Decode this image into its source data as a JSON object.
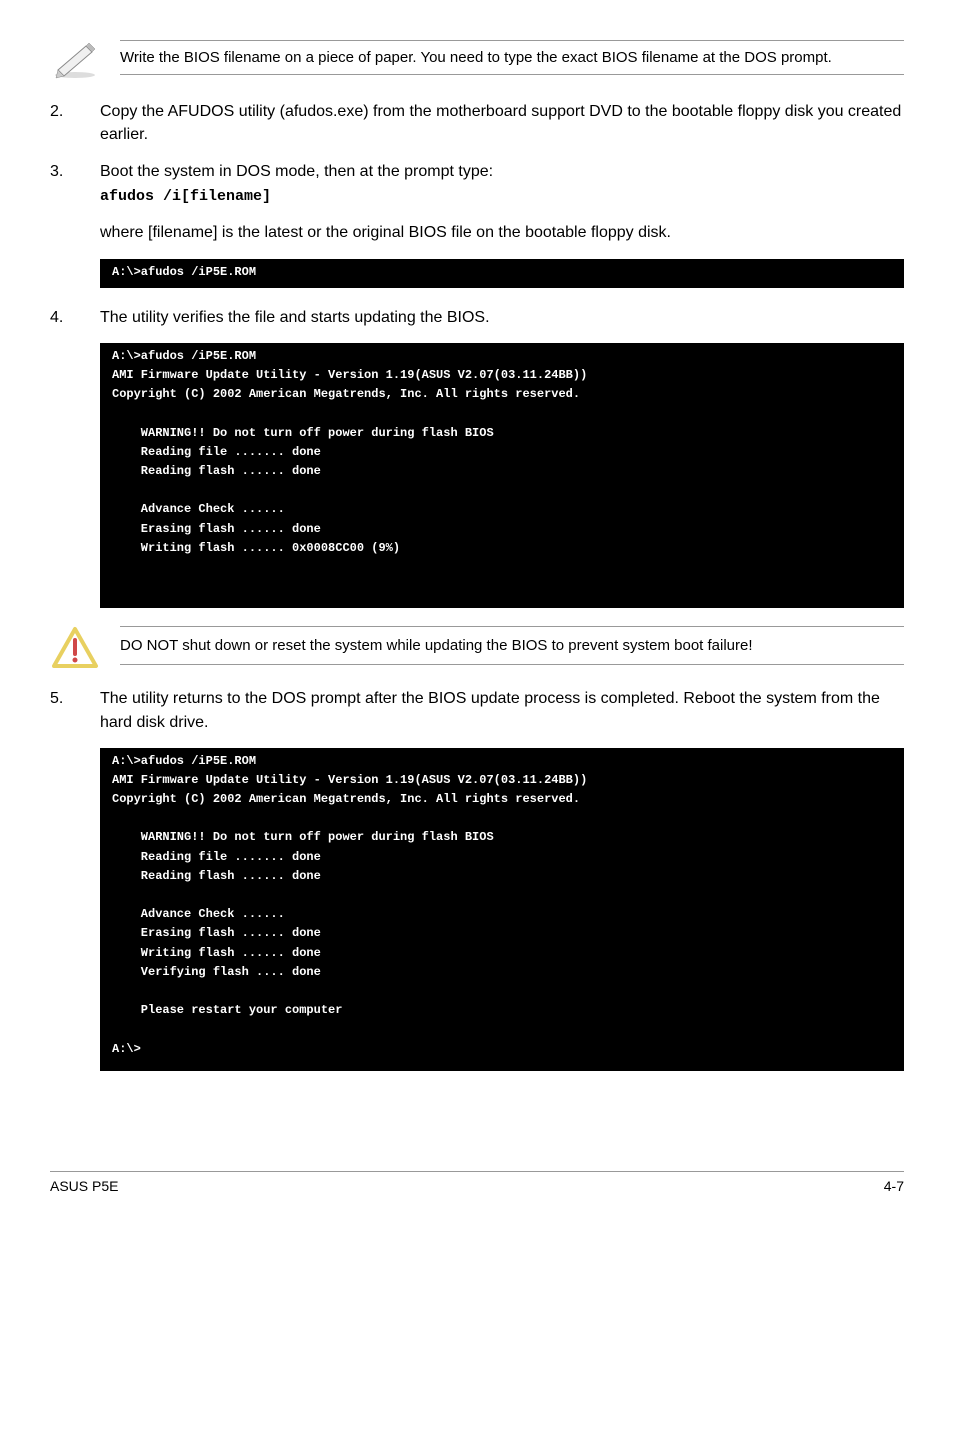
{
  "note": "Write the BIOS filename on a piece of paper. You need to type the exact BIOS filename at the DOS prompt.",
  "steps": {
    "s2": {
      "num": "2.",
      "text": "Copy the AFUDOS utility (afudos.exe) from the motherboard support DVD to the bootable floppy disk you created earlier."
    },
    "s3": {
      "num": "3.",
      "line1": "Boot the system in DOS mode, then at the prompt type:",
      "cmd": "afudos /i[filename]",
      "para": "where [filename] is the latest or the original BIOS file on the bootable floppy disk."
    },
    "s4": {
      "num": "4.",
      "text": "The utility verifies the file and starts updating the BIOS."
    },
    "s5": {
      "num": "5.",
      "text": "The utility returns to the DOS prompt after the BIOS update process is completed. Reboot the system from the hard disk drive."
    }
  },
  "terminals": {
    "t1": "A:\\>afudos /iP5E.ROM",
    "t2": "A:\\>afudos /iP5E.ROM\nAMI Firmware Update Utility - Version 1.19(ASUS V2.07(03.11.24BB))\nCopyright (C) 2002 American Megatrends, Inc. All rights reserved.\n\n    WARNING!! Do not turn off power during flash BIOS\n    Reading file ....... done\n    Reading flash ...... done\n\n    Advance Check ......\n    Erasing flash ...... done\n    Writing flash ...... 0x0008CC00 (9%)\n\n\n",
    "t3": "A:\\>afudos /iP5E.ROM\nAMI Firmware Update Utility - Version 1.19(ASUS V2.07(03.11.24BB))\nCopyright (C) 2002 American Megatrends, Inc. All rights reserved.\n\n    WARNING!! Do not turn off power during flash BIOS\n    Reading file ....... done\n    Reading flash ...... done\n\n    Advance Check ......\n    Erasing flash ...... done\n    Writing flash ...... done\n    Verifying flash .... done\n\n    Please restart your computer\n\nA:\\>"
  },
  "warning": "DO NOT shut down or reset the system while updating the BIOS to prevent system boot failure!",
  "footer": {
    "left": "ASUS P5E",
    "right": "4-7"
  }
}
